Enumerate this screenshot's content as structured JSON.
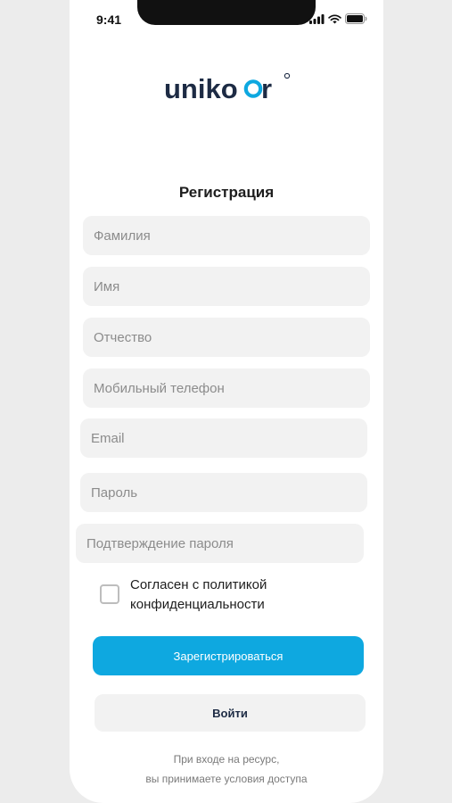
{
  "status_bar": {
    "time": "9:41"
  },
  "logo": {
    "text": "unikoor"
  },
  "form": {
    "title": "Регистрация",
    "fields": [
      {
        "placeholder": "Фамилия",
        "value": ""
      },
      {
        "placeholder": "Имя",
        "value": ""
      },
      {
        "placeholder": "Отчество",
        "value": ""
      },
      {
        "placeholder": "Мобильный телефон",
        "value": ""
      },
      {
        "placeholder": "Email",
        "value": ""
      },
      {
        "placeholder": "Пароль",
        "value": ""
      },
      {
        "placeholder": "Подтверждение пароля",
        "value": ""
      }
    ],
    "consent": {
      "label": "Согласен с политикой конфиденциальности",
      "checked": false
    },
    "register_label": "Зарегистрироваться",
    "login_label": "Войти"
  },
  "footer": {
    "line1": "При входе на ресурс,",
    "line2": "вы принимаете условия доступа"
  },
  "colors": {
    "primary": "#0ea8e0",
    "logo_dark": "#1d2b44",
    "logo_accent": "#0ea8e0",
    "field_bg": "#f2f2f2",
    "page_bg": "#ececec"
  }
}
